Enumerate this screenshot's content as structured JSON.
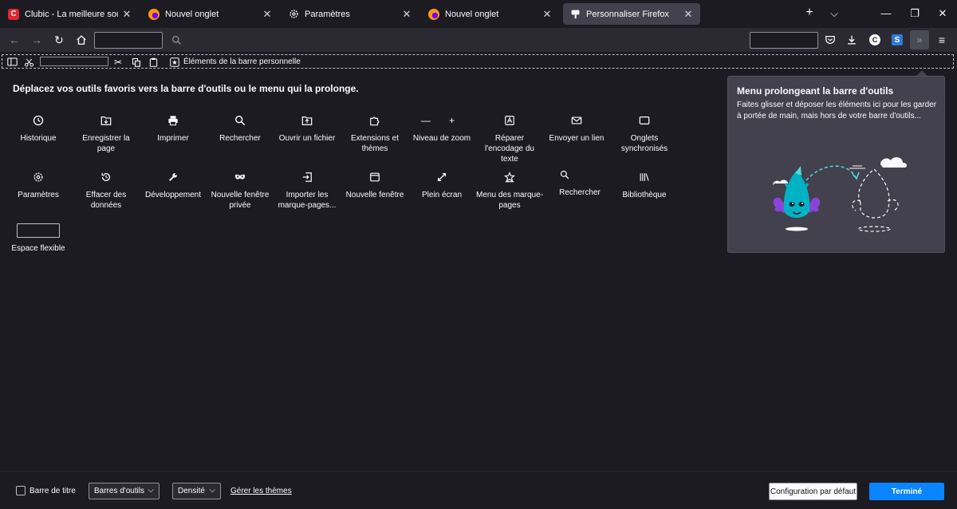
{
  "tabs": [
    {
      "title": "Clubic - La meilleure source d'in",
      "icon": "clubic-favicon",
      "active": false
    },
    {
      "title": "Nouvel onglet",
      "icon": "firefox-favicon",
      "active": false
    },
    {
      "title": "Paramètres",
      "icon": "gear-favicon",
      "active": false
    },
    {
      "title": "Nouvel onglet",
      "icon": "firefox-favicon",
      "active": false
    },
    {
      "title": "Personnaliser Firefox",
      "icon": "customize-favicon",
      "active": true
    }
  ],
  "personal_bar": {
    "label": "Éléments de la barre personnelle"
  },
  "heading": "Déplacez vos outils favoris vers la barre d'outils ou le menu qui la prolonge.",
  "palette": [
    {
      "label": "Historique",
      "icon": "clock-icon"
    },
    {
      "label": "Enregistrer la page",
      "icon": "save-page-icon"
    },
    {
      "label": "Imprimer",
      "icon": "printer-icon"
    },
    {
      "label": "Rechercher",
      "icon": "search-icon"
    },
    {
      "label": "Ouvrir un fichier",
      "icon": "open-file-icon"
    },
    {
      "label": "Extensions et thèmes",
      "icon": "puzzle-icon"
    },
    {
      "label": "Niveau de zoom",
      "icon": "zoom-icon"
    },
    {
      "label": "Réparer l'encodage du texte",
      "icon": "text-encoding-icon"
    },
    {
      "label": "Envoyer un lien",
      "icon": "mail-icon"
    },
    {
      "label": "Onglets synchronisés",
      "icon": "synced-tabs-icon"
    },
    {
      "label": "Paramètres",
      "icon": "gear-icon"
    },
    {
      "label": "Effacer des données",
      "icon": "forget-icon"
    },
    {
      "label": "Développement",
      "icon": "wrench-icon"
    },
    {
      "label": "Nouvelle fenêtre privée",
      "icon": "private-mask-icon"
    },
    {
      "label": "Importer les marque-pages...",
      "icon": "import-icon"
    },
    {
      "label": "Nouvelle fenêtre",
      "icon": "new-window-icon"
    },
    {
      "label": "Plein écran",
      "icon": "fullscreen-icon"
    },
    {
      "label": "Menu des marque-pages",
      "icon": "bookmark-star-icon"
    },
    {
      "label": "Rechercher",
      "icon": "search-field-icon"
    },
    {
      "label": "Bibliothèque",
      "icon": "library-icon"
    },
    {
      "label": "Espace flexible",
      "icon": "flexible-space"
    }
  ],
  "overflow_panel": {
    "title": "Menu prolongeant la barre d'outils",
    "description": "Faites glisser et déposer les éléments ici pour les garder à portée de main, mais hors de votre barre d'outils..."
  },
  "footer": {
    "title_bar_label": "Barre de titre",
    "title_bar_checked": false,
    "toolbars_select": "Barres d'outils",
    "density_select": "Densité",
    "manage_themes": "Gérer les thèmes",
    "reset_button": "Configuration par défaut",
    "done_button": "Terminé"
  },
  "colors": {
    "background": "#1c1b22",
    "toolbar": "#2b2a33",
    "panel": "#42414d",
    "accent": "#0a84ff"
  }
}
